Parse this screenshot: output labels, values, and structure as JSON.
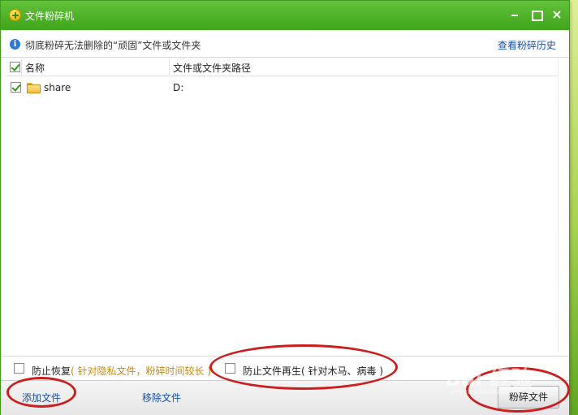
{
  "window": {
    "title": "文件粉碎机"
  },
  "info": {
    "text": "彻底粉碎无法删除的“顽固”文件或文件夹",
    "history_link": "查看粉碎历史"
  },
  "table": {
    "columns": [
      "名称",
      "文件或文件夹路径"
    ],
    "header_checked": true,
    "rows": [
      {
        "name": "share",
        "path": "D:",
        "checked": true,
        "icon": "folder-icon"
      }
    ]
  },
  "options": {
    "prevent_recovery": {
      "label": "防止恢复",
      "hint": "( 针对隐私文件，粉碎时间较长 )",
      "checked": false
    },
    "prevent_regen": {
      "label": "防止文件再生",
      "hint": "( 针对木马、病毒 )",
      "checked": false
    }
  },
  "footer": {
    "add_file": "添加文件",
    "remove_file": "移除文件",
    "shred_button": "粉碎文件"
  },
  "watermark": {
    "main": "Bai 经验",
    "sub": "jingyan.baidu.com"
  },
  "colors": {
    "titlebar": "#4fb02a",
    "link": "#1a4fa8",
    "hint": "#c88a10",
    "annotation": "#cc1e1e"
  }
}
